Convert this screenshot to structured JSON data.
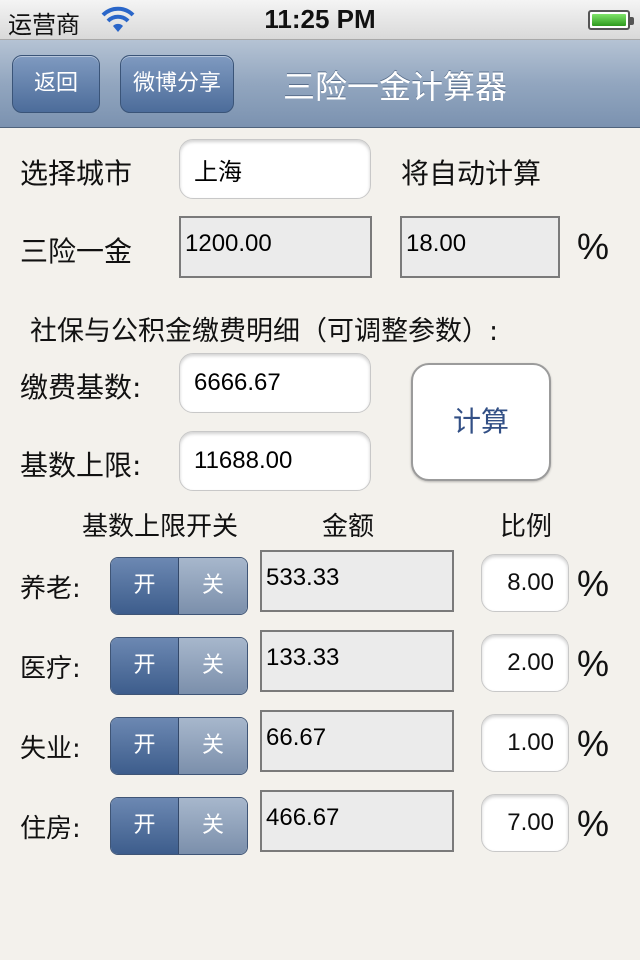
{
  "status_bar": {
    "carrier": "运营商",
    "time": "11:25 PM"
  },
  "nav": {
    "back_label": "返回",
    "share_label": "微博分享",
    "title": "三险一金计算器"
  },
  "city": {
    "label": "选择城市",
    "value": "上海",
    "auto_note": "将自动计算"
  },
  "total": {
    "label": "三险一金",
    "amount": "1200.00",
    "percent": "18.00",
    "percent_sign": "%"
  },
  "detail_heading": "社保与公积金缴费明细（可调整参数）:",
  "base": {
    "label": "缴费基数:",
    "value": "6666.67"
  },
  "limit": {
    "label": "基数上限:",
    "value": "11688.00"
  },
  "calc_label": "计算",
  "columns": {
    "switch": "基数上限开关",
    "amount": "金额",
    "rate": "比例"
  },
  "switch_labels": {
    "on": "开",
    "off": "关"
  },
  "items": [
    {
      "label": "养老:",
      "amount": "533.33",
      "rate": "8.00",
      "pct": "%"
    },
    {
      "label": "医疗:",
      "amount": "133.33",
      "rate": "2.00",
      "pct": "%"
    },
    {
      "label": "失业:",
      "amount": "66.67",
      "rate": "1.00",
      "pct": "%"
    },
    {
      "label": "住房:",
      "amount": "466.67",
      "rate": "7.00",
      "pct": "%"
    }
  ]
}
